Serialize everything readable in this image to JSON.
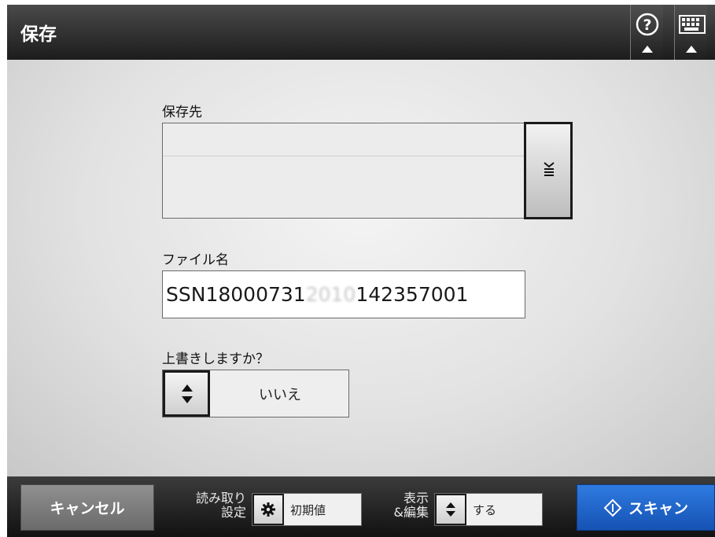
{
  "header": {
    "title": "保存",
    "help_icon": "question-circle-icon",
    "keyboard_icon": "keyboard-icon"
  },
  "destination": {
    "label": "保存先",
    "items": [
      "",
      ""
    ],
    "scroll_icon": "list-scroll-icon"
  },
  "filename": {
    "label": "ファイル名",
    "value_prefix": "SSN18000731",
    "value_obscured": "2010",
    "value_suffix": "142357001"
  },
  "overwrite": {
    "label": "上書きしますか？",
    "value": "いいえ",
    "toggle_icon": "up-down-arrows-icon"
  },
  "footer": {
    "cancel_label": "キャンセル",
    "scan_settings_label_line1": "読み取り",
    "scan_settings_label_line2": "設定",
    "scan_settings_icon": "gear-icon",
    "scan_settings_value": "初期値",
    "display_edit_label_line1": "表示",
    "display_edit_label_line2": "&編集",
    "display_edit_icon": "up-down-arrows-icon",
    "display_edit_value": "する",
    "scan_label": "スキャン",
    "scan_icon": "scan-diamond-icon"
  },
  "colors": {
    "scan_button": "#1f66cc",
    "header_bg": "#1c1c1c",
    "cancel_button": "#7c7c7c"
  }
}
